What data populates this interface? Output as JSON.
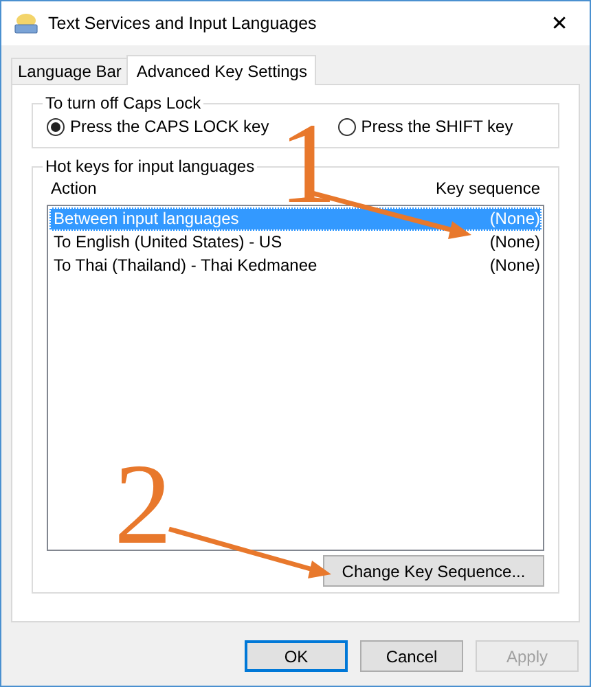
{
  "window": {
    "title": "Text Services and Input Languages",
    "close": "✕"
  },
  "tabs": [
    {
      "label": "Language Bar",
      "selected": false
    },
    {
      "label": "Advanced Key Settings",
      "selected": true
    }
  ],
  "caps_lock": {
    "legend": "To turn off Caps Lock",
    "options": [
      {
        "label": "Press the CAPS LOCK key",
        "selected": true
      },
      {
        "label": "Press the SHIFT key",
        "selected": false
      }
    ]
  },
  "hot_keys": {
    "legend": "Hot keys for input languages",
    "columns": [
      "Action",
      "Key sequence"
    ],
    "rows": [
      {
        "action": "Between input languages",
        "key_sequence": "(None)",
        "selected": true
      },
      {
        "action": "To English (United States) - US",
        "key_sequence": "(None)",
        "selected": false
      },
      {
        "action": "To Thai (Thailand) - Thai Kedmanee",
        "key_sequence": "(None)",
        "selected": false
      }
    ],
    "button": "Change Key Sequence..."
  },
  "buttons": [
    {
      "label": "OK",
      "default": true,
      "disabled": false
    },
    {
      "label": "Cancel",
      "default": false,
      "disabled": false
    },
    {
      "label": "Apply",
      "default": false,
      "disabled": true
    }
  ],
  "annotations": [
    {
      "label": "1"
    },
    {
      "label": "2"
    }
  ]
}
